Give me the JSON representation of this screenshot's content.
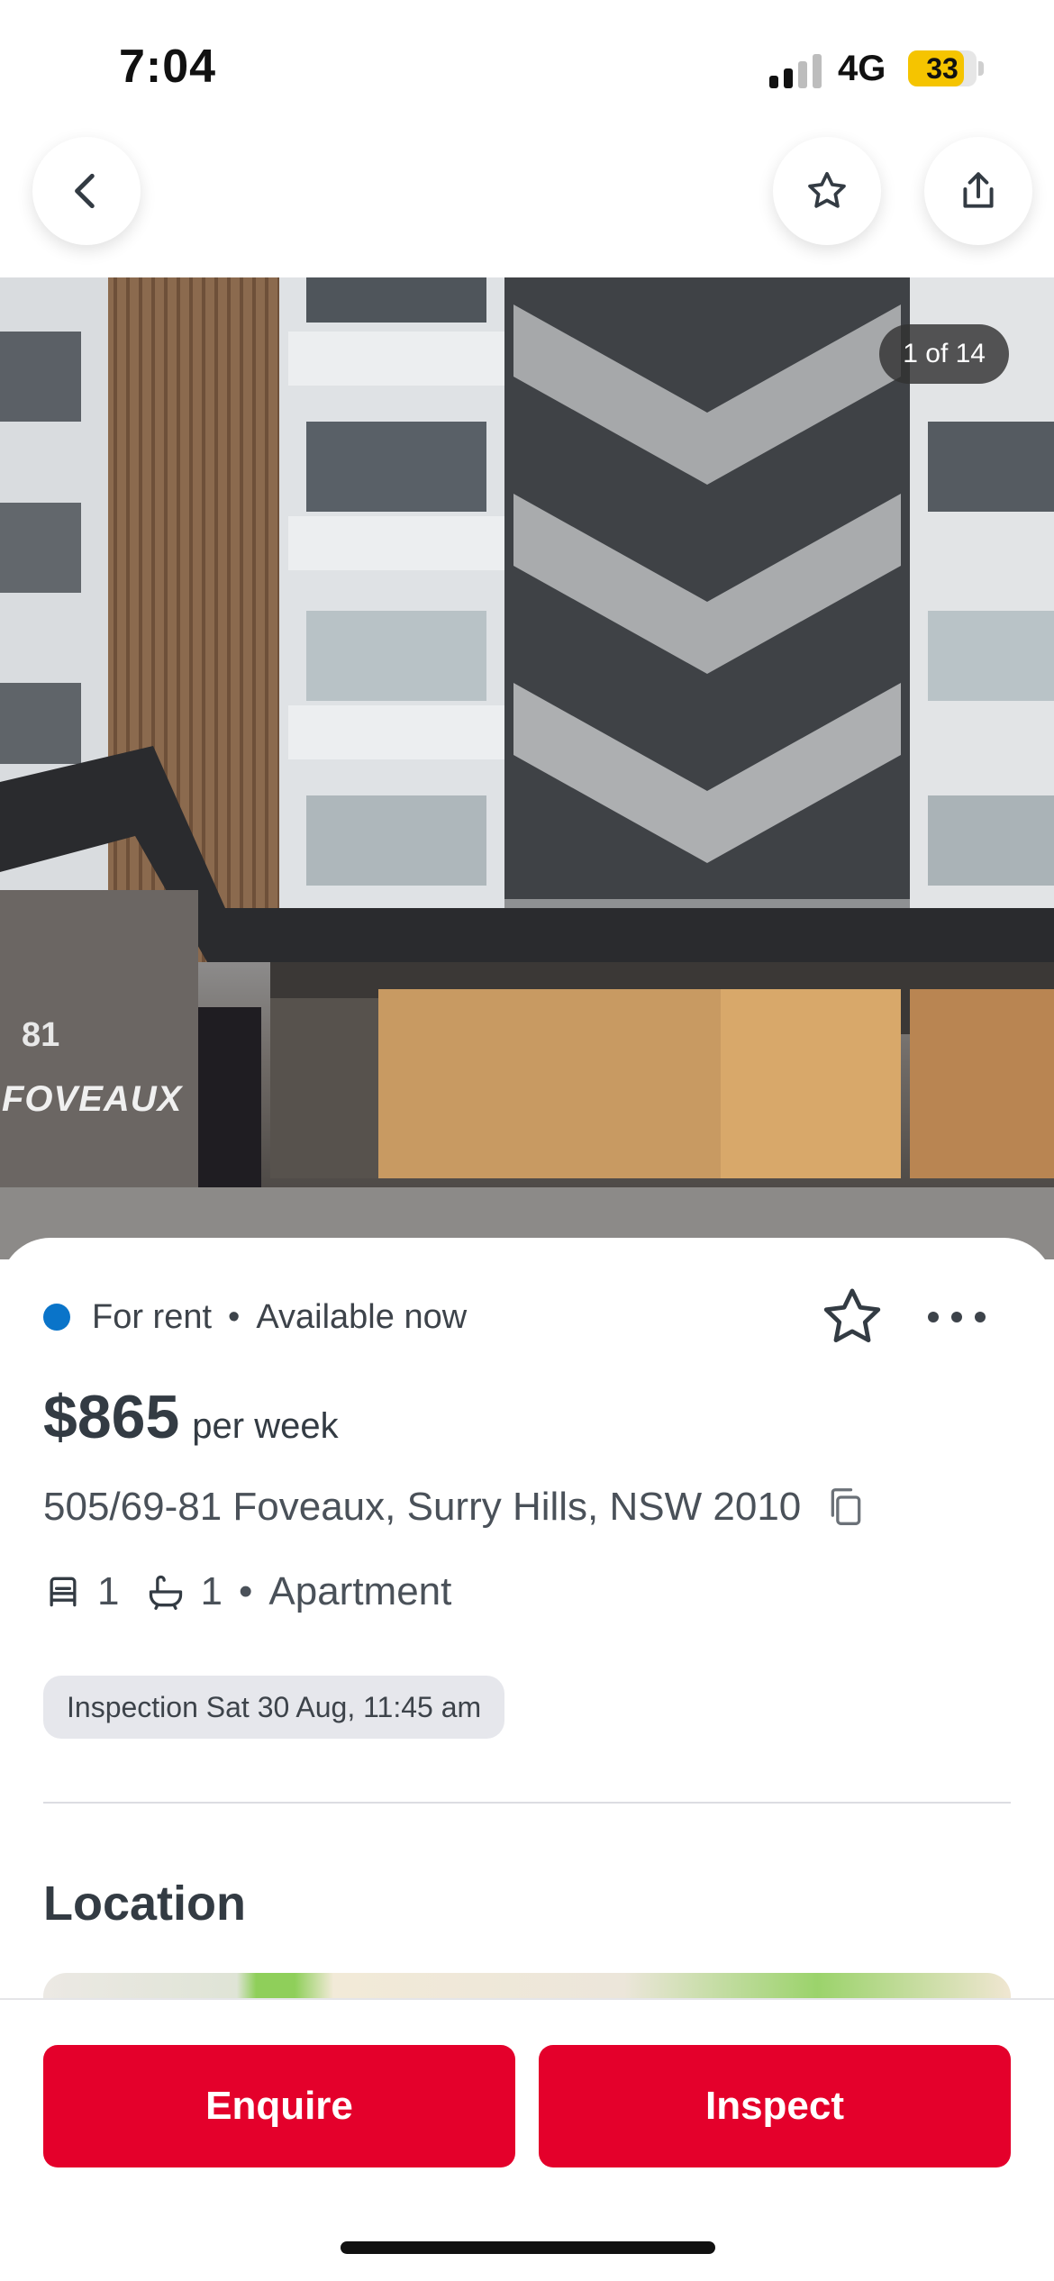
{
  "status_bar": {
    "time": "7:04",
    "network": "4G",
    "battery": "33",
    "battery_level": 0.33,
    "signal_icon": "signal-bars-icon"
  },
  "nav": {
    "back_icon": "chevron-left-icon",
    "save_icon": "star-icon",
    "share_icon": "share-icon"
  },
  "gallery": {
    "counter": "1 of 14",
    "sign_number": "81",
    "sign_name": "FOVEAUX"
  },
  "listing": {
    "status_dot_color": "#0a74c9",
    "status": "For rent",
    "availability": "Available now",
    "price": "$865",
    "price_unit": "per week",
    "address": "505/69-81 Foveaux, Surry Hills, NSW 2010",
    "bedrooms": "1",
    "bathrooms": "1",
    "property_type": "Apartment",
    "inspection": "Inspection Sat 30 Aug, 11:45 am"
  },
  "location": {
    "title": "Location"
  },
  "actions": {
    "enquire": "Enquire",
    "inspect": "Inspect",
    "accent_color": "#e4002b"
  }
}
